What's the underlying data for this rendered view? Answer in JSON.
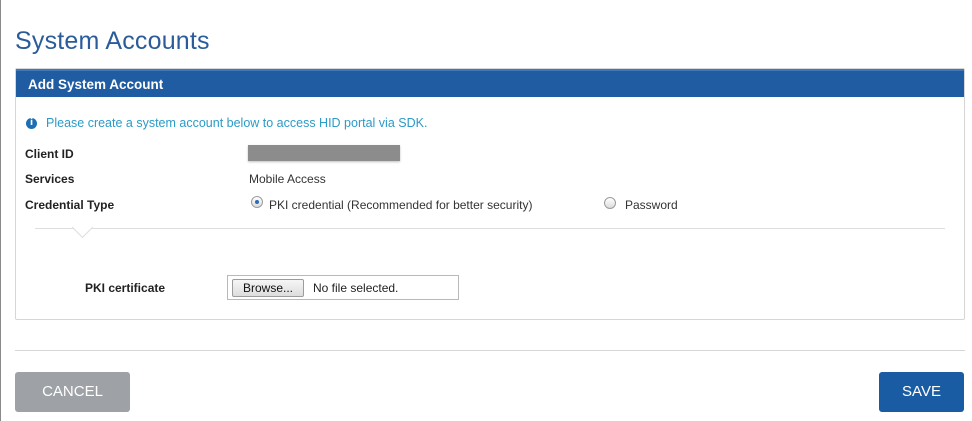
{
  "page": {
    "title": "System Accounts"
  },
  "panel": {
    "header": "Add System Account",
    "info_text": "Please create a system account below to access HID portal via SDK.",
    "fields": {
      "client_id_label": "Client ID",
      "services_label": "Services",
      "services_value": "Mobile Access",
      "credential_type_label": "Credential Type"
    },
    "credential_options": [
      {
        "label": "PKI credential (Recommended for better security)",
        "selected": true
      },
      {
        "label": "Password",
        "selected": false
      }
    ],
    "pki": {
      "label": "PKI certificate",
      "browse_label": "Browse...",
      "file_status": "No file selected."
    }
  },
  "actions": {
    "cancel_label": "CANCEL",
    "save_label": "SAVE"
  },
  "colors": {
    "brand_blue": "#1f5ca2",
    "info_text": "#2b9bc7",
    "cancel_bg": "#9ea2a6",
    "save_bg": "#1a5ca3"
  },
  "icons": {
    "info": "info-circle-icon",
    "radio_selected": "radio-selected-icon",
    "radio_unselected": "radio-unselected-icon"
  }
}
